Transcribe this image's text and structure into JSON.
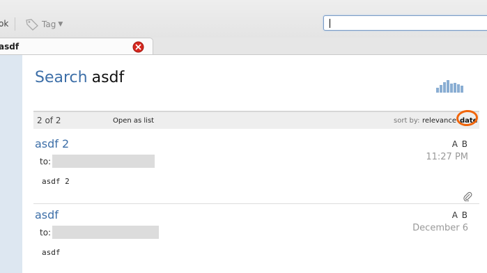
{
  "toolbar": {
    "partial_label": "ok",
    "tag_label": "Tag",
    "search_value": ""
  },
  "tab": {
    "label": "asdf"
  },
  "search": {
    "title_word": "Search",
    "query": "asdf"
  },
  "results_bar": {
    "count": "2 of 2",
    "open_as_list": "Open as list",
    "sort_by": "sort by:",
    "sort_relevance": "relevance",
    "sort_date": "date"
  },
  "results": [
    {
      "subject": "asdf 2",
      "to_label": "to:",
      "tags": "A B",
      "time": "11:27 PM",
      "snippet": "asdf 2",
      "has_attachment": true
    },
    {
      "subject": "asdf",
      "to_label": "to:",
      "tags": "A B",
      "time": "December 6",
      "snippet": "asdf",
      "has_attachment": false
    }
  ],
  "colors": {
    "link_blue": "#3d6fa8",
    "annotation_orange": "#f0650b",
    "close_red": "#d6281f"
  },
  "icons": [
    "tag-icon",
    "close-icon",
    "histogram-icon",
    "paperclip-icon"
  ]
}
